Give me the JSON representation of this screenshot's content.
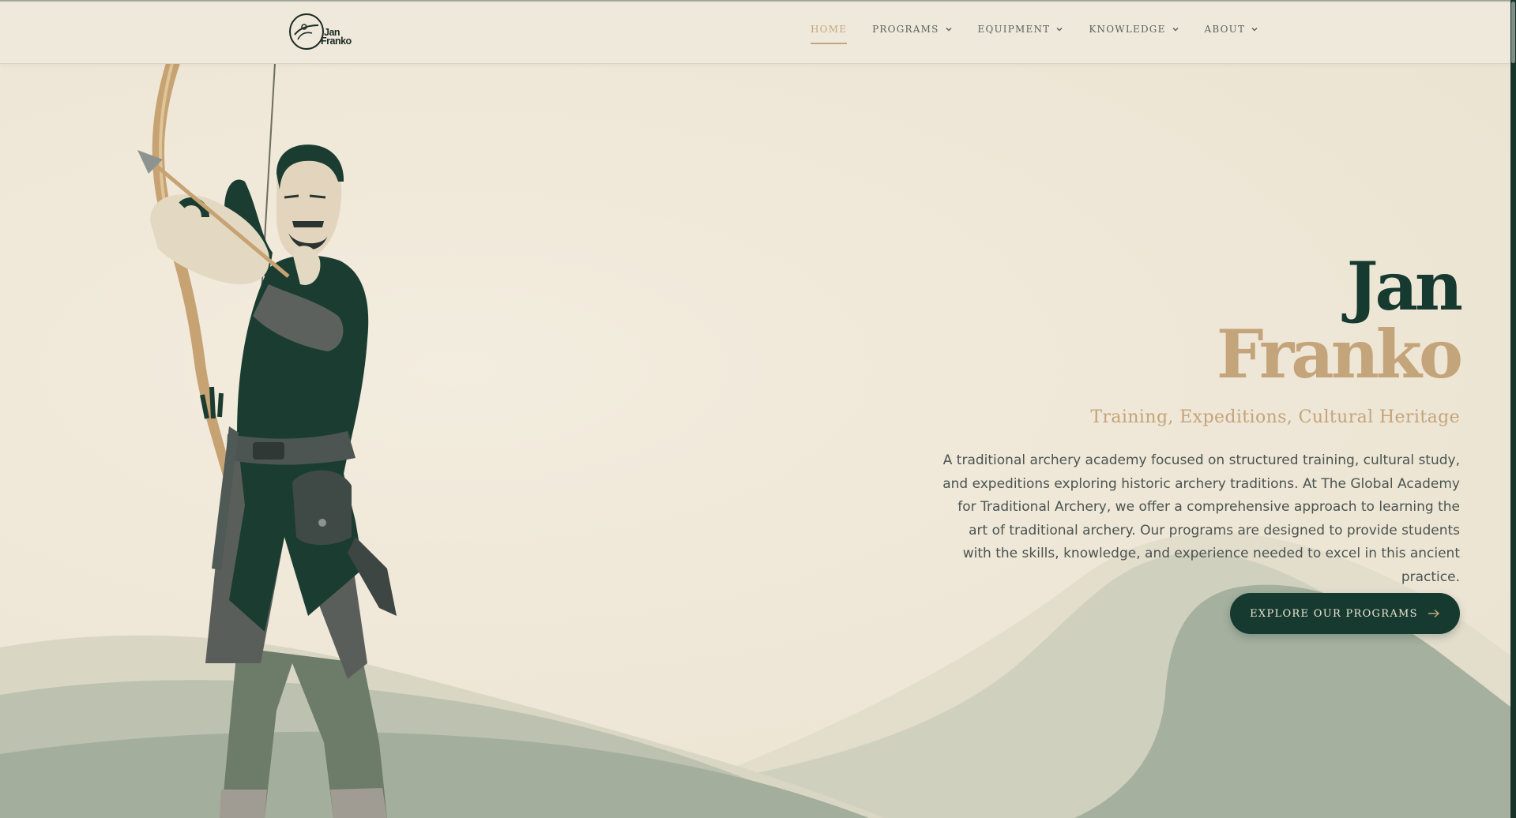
{
  "brand": {
    "logo_line1": "Jan",
    "logo_line2": "Franko"
  },
  "nav": {
    "items": [
      {
        "label": "HOME",
        "active": true,
        "has_dropdown": false
      },
      {
        "label": "PROGRAMS",
        "active": false,
        "has_dropdown": true
      },
      {
        "label": "EQUIPMENT",
        "active": false,
        "has_dropdown": true
      },
      {
        "label": "KNOWLEDGE",
        "active": false,
        "has_dropdown": true
      },
      {
        "label": "ABOUT",
        "active": false,
        "has_dropdown": true
      }
    ]
  },
  "hero": {
    "first_name": "Jan",
    "last_name": "Franko",
    "subtitle": "Training, Expeditions, Cultural Heritage",
    "description": "A traditional archery academy focused on structured training, cultural study, and expeditions exploring historic archery traditions. At The Global Academy for Traditional Archery, we offer a comprehensive approach to learning the art of traditional archery. Our programs are designed to provide students with the skills, knowledge, and experience needed to excel in this ancient practice.",
    "cta_label": "EXPLORE OUR PROGRAMS"
  },
  "icons": {
    "chevron": "chevron-down-icon",
    "cta_arrow": "arrow-right-icon",
    "logo": "archer-logo-icon"
  },
  "colors": {
    "background": "#efe8d9",
    "dark_green": "#173a30",
    "gold": "#c4a47a",
    "text_gray": "#4a5451",
    "hill_light": "#d8d5c4",
    "hill_mid": "#b9bfae",
    "hill_dark": "#a3ae9c"
  }
}
